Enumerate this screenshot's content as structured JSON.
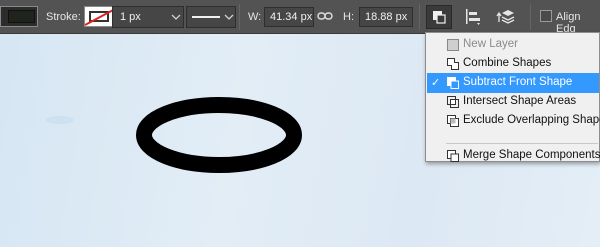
{
  "options_bar": {
    "stroke_label": "Stroke:",
    "stroke_width": "1 px",
    "width_label": "W:",
    "width_value": "41.34 px",
    "link_icon": "link-icon",
    "height_label": "H:",
    "height_value": "18.88 px",
    "align_edges_label": "Align Edg"
  },
  "menu": {
    "items": [
      {
        "label": "New Layer",
        "state": "disabled",
        "icon": "new-layer-icon"
      },
      {
        "label": "Combine Shapes",
        "state": "normal",
        "icon": "combine-shapes-icon"
      },
      {
        "label": "Subtract Front Shape",
        "state": "selected",
        "checked": true,
        "icon": "subtract-front-shape-icon"
      },
      {
        "label": "Intersect Shape Areas",
        "state": "normal",
        "icon": "intersect-shape-areas-icon"
      },
      {
        "label": "Exclude Overlapping Shape",
        "state": "normal",
        "icon": "exclude-overlapping-shapes-icon"
      },
      {
        "label": "Merge Shape Components",
        "state": "normal",
        "icon": "merge-shape-components-icon"
      }
    ],
    "check_glyph": "✓"
  },
  "colors": {
    "toolbar_bg": "#535353",
    "menu_highlight": "#3399ff",
    "canvas_bg": "#dde9f3",
    "shape_stroke": "#000000"
  }
}
